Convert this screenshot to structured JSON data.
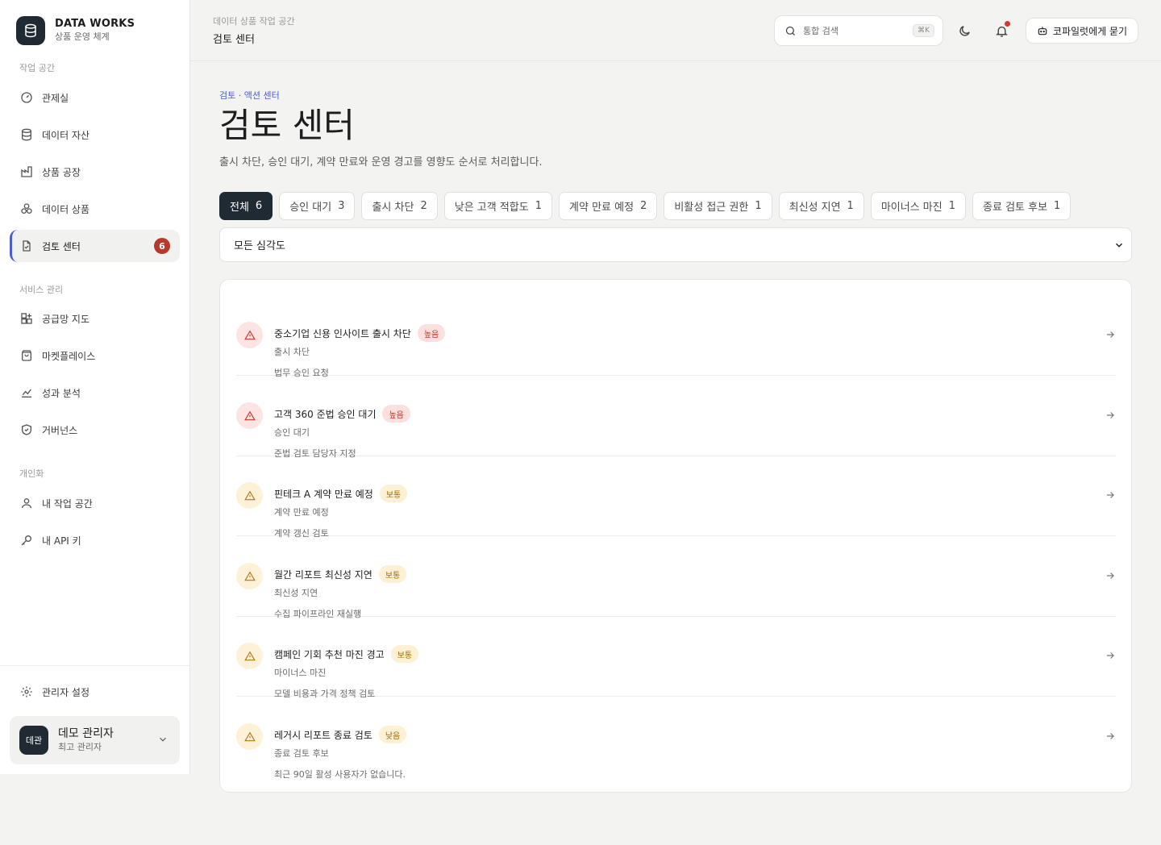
{
  "brand": {
    "name": "DATA WORKS",
    "subtitle": "상품 운영 체계"
  },
  "sidebar": {
    "sections": [
      {
        "label": "작업 공간"
      },
      {
        "label": "서비스 관리"
      },
      {
        "label": "개인화"
      }
    ],
    "items": [
      {
        "label": "관제실",
        "icon": "gauge-icon"
      },
      {
        "label": "데이터 자산",
        "icon": "database-icon"
      },
      {
        "label": "상품 공장",
        "icon": "factory-icon"
      },
      {
        "label": "데이터 상품",
        "icon": "boxes-icon"
      },
      {
        "label": "검토 센터",
        "icon": "file-check-icon",
        "badge": "6",
        "active": true
      },
      {
        "label": "공급망 지도",
        "icon": "grid-plus-icon"
      },
      {
        "label": "마켓플레이스",
        "icon": "shopping-bag-icon"
      },
      {
        "label": "성과 분석",
        "icon": "line-chart-icon"
      },
      {
        "label": "거버넌스",
        "icon": "shield-check-icon"
      },
      {
        "label": "내 작업 공간",
        "icon": "user-icon"
      },
      {
        "label": "내 API 키",
        "icon": "key-icon"
      },
      {
        "label": "관리자 설정",
        "icon": "gear-icon"
      }
    ],
    "user": {
      "avatar": "데관",
      "name": "데모 관리자",
      "role": "최고 관리자"
    }
  },
  "topbar": {
    "breadcrumb": "데이터 상품 작업 공간",
    "title": "검토 센터",
    "search_placeholder": "통합 검색",
    "search_shortcut": "⌘K",
    "copilot_label": "코파일럿에게 묻기"
  },
  "main": {
    "breadcrumb": "검토 · 액션 센터",
    "title": "검토 센터",
    "description": "출시 차단, 승인 대기, 계약 만료와 운영 경고를 영향도 순서로 처리합니다.",
    "filters": [
      {
        "label": "전체",
        "count": "6",
        "active": true
      },
      {
        "label": "승인 대기",
        "count": "3"
      },
      {
        "label": "출시 차단",
        "count": "2"
      },
      {
        "label": "낮은 고객 적합도",
        "count": "1"
      },
      {
        "label": "계약 만료 예정",
        "count": "2"
      },
      {
        "label": "비활성 접근 권한",
        "count": "1"
      },
      {
        "label": "최신성 지연",
        "count": "1"
      },
      {
        "label": "마이너스 마진",
        "count": "1"
      },
      {
        "label": "종료 검토 후보",
        "count": "1"
      }
    ],
    "severity_select": "모든 심각도",
    "items": [
      {
        "title": "중소기업 신용 인사이트 출시 차단",
        "severity": "높음",
        "level": "high",
        "category": "출시 차단",
        "action": "법무 승인 요청"
      },
      {
        "title": "고객 360 준법 승인 대기",
        "severity": "높음",
        "level": "high",
        "category": "승인 대기",
        "action": "준법 검토 담당자 지정"
      },
      {
        "title": "핀테크 A 계약 만료 예정",
        "severity": "보통",
        "level": "mid",
        "category": "계약 만료 예정",
        "action": "계약 갱신 검토"
      },
      {
        "title": "월간 리포트 최신성 지연",
        "severity": "보통",
        "level": "mid",
        "category": "최신성 지연",
        "action": "수집 파이프라인 재실행"
      },
      {
        "title": "캠페인 기회 추천 마진 경고",
        "severity": "보통",
        "level": "mid",
        "category": "마이너스 마진",
        "action": "모델 비용과 가격 정책 검토"
      },
      {
        "title": "레거시 리포트 종료 검토",
        "severity": "낮음",
        "level": "mid",
        "category": "종료 검토 후보",
        "action": "최근 90일 활성 사용자가 없습니다."
      }
    ]
  },
  "colors": {
    "accent": "#4b5bd6",
    "dark": "#1f2a33",
    "danger": "#b8382c",
    "warning": "#a06a0a"
  }
}
